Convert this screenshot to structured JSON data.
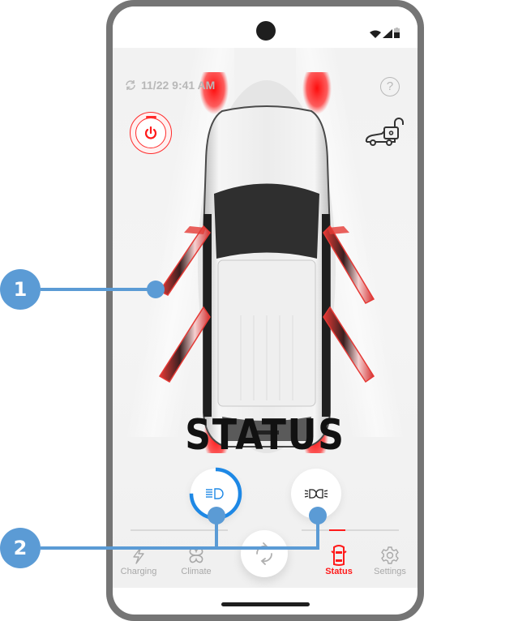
{
  "status_bar": {
    "icons": [
      "wifi-icon",
      "cellular-signal-icon",
      "battery-icon"
    ]
  },
  "header": {
    "sync_icon": "sync-icon",
    "last_updated": "11/22 9:41 AM",
    "help_label": "?"
  },
  "controls": {
    "power_icon": "power-icon",
    "trunk_lock_icon": "trunk-unlock-icon"
  },
  "vehicle": {
    "doors_open": [
      "front-left",
      "front-right",
      "rear-left",
      "rear-right"
    ],
    "headlights_on": true,
    "taillights_on": true
  },
  "page_title": "STATUS",
  "lights": [
    {
      "name": "low-beam",
      "icon": "low-beam-headlight-icon",
      "active": true,
      "progress": 0.75
    },
    {
      "name": "fog-lights",
      "icon": "fog-light-icon",
      "active": false
    }
  ],
  "tabs": [
    {
      "label": "Charging",
      "icon": "lightning-icon",
      "active": false
    },
    {
      "label": "Climate",
      "icon": "fan-icon",
      "active": false
    },
    {
      "label": "Status",
      "icon": "car-doors-icon",
      "active": true
    },
    {
      "label": "Settings",
      "icon": "gear-icon",
      "active": false
    }
  ],
  "fab": {
    "icon": "refresh-icon"
  },
  "callouts": [
    {
      "number": "1"
    },
    {
      "number": "2"
    }
  ],
  "colors": {
    "accent_red": "#ff1a1a",
    "accent_blue": "#1e88e5",
    "callout_blue": "#5b9bd5",
    "inactive_gray": "#a8a8a8"
  }
}
